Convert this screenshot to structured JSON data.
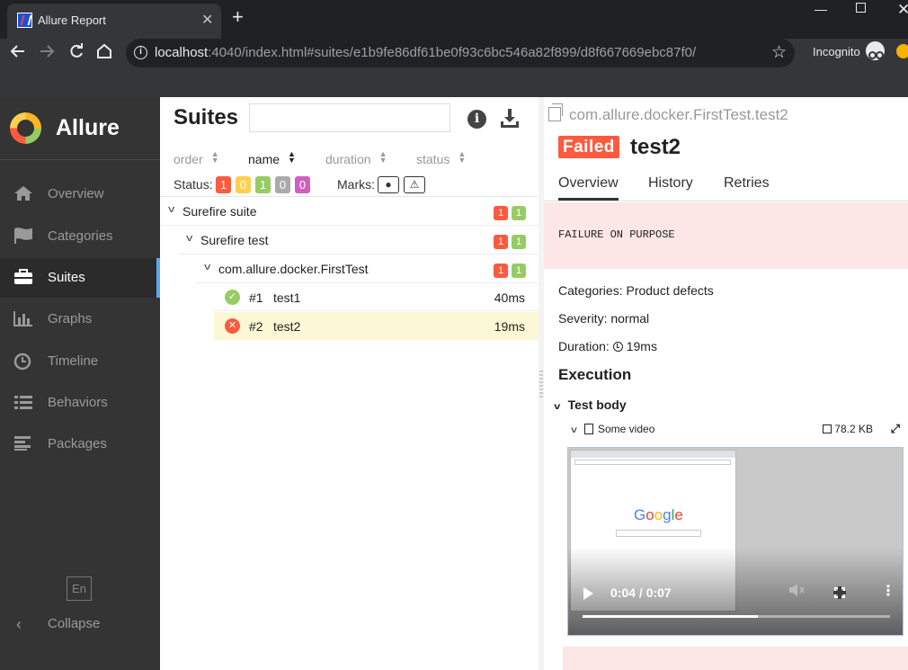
{
  "browser": {
    "tab_title": "Allure Report",
    "tab_close": "✕",
    "new_tab": "+",
    "url_host": "localhost",
    "url_rest": ":4040/index.html#suites/e1b9fe86df61be0f93c6bc546a82f899/d8f667669ebc87f0/",
    "incognito_label": "Incognito",
    "win_min": "—",
    "win_close": "✕",
    "icons": {
      "back": "arrow-left-icon",
      "forward": "arrow-right-icon",
      "reload": "reload-icon",
      "home": "home-icon",
      "star": "star-icon"
    }
  },
  "sidebar": {
    "brand": "Allure",
    "items": [
      {
        "label": "Overview",
        "icon": "home-icon",
        "active": false
      },
      {
        "label": "Categories",
        "icon": "flag-icon",
        "active": false
      },
      {
        "label": "Suites",
        "icon": "briefcase-icon",
        "active": true
      },
      {
        "label": "Graphs",
        "icon": "bar-chart-icon",
        "active": false
      },
      {
        "label": "Timeline",
        "icon": "clock-icon",
        "active": false
      },
      {
        "label": "Behaviors",
        "icon": "list-icon",
        "active": false
      },
      {
        "label": "Packages",
        "icon": "align-left-icon",
        "active": false
      }
    ],
    "language": "En",
    "collapse": "Collapse"
  },
  "suites": {
    "title": "Suites",
    "search_value": "",
    "columns": [
      "order",
      "name",
      "duration",
      "status"
    ],
    "sorted_column": "name",
    "status_label": "Status:",
    "status_counts": [
      {
        "value": "1",
        "color": "#fd5a3e",
        "status": "failed"
      },
      {
        "value": "0",
        "color": "#ffd050",
        "status": "broken"
      },
      {
        "value": "1",
        "color": "#97cc64",
        "status": "passed"
      },
      {
        "value": "0",
        "color": "#aaaaaa",
        "status": "skipped"
      },
      {
        "value": "0",
        "color": "#d35ebe",
        "status": "unknown"
      }
    ],
    "marks_label": "Marks:",
    "marks": [
      {
        "icon": "bomb-icon",
        "glyph": "💣"
      },
      {
        "icon": "warning-icon",
        "glyph": "⚠"
      }
    ],
    "tree": [
      {
        "label": "Surefire suite",
        "failed": "1",
        "passed": "1"
      },
      {
        "label": "Surefire test",
        "failed": "1",
        "passed": "1"
      },
      {
        "label": "com.allure.docker.FirstTest",
        "failed": "1",
        "passed": "1"
      }
    ],
    "tests": [
      {
        "num": "#1",
        "name": "test1",
        "duration": "40ms",
        "status": "passed",
        "selected": false
      },
      {
        "num": "#2",
        "name": "test2",
        "duration": "19ms",
        "status": "failed",
        "selected": true
      }
    ]
  },
  "detail": {
    "path": "com.allure.docker.FirstTest.test2",
    "status": "Failed",
    "name": "test2",
    "tabs": [
      "Overview",
      "History",
      "Retries"
    ],
    "active_tab": "Overview",
    "failure_message": "FAILURE ON PURPOSE",
    "categories_line": "Categories: Product defects",
    "severity_line": "Severity: normal",
    "duration_label": "Duration:",
    "duration_value": "19ms",
    "execution_title": "Execution",
    "test_body_title": "Test body",
    "attachment": {
      "name": "Some video",
      "size": "78.2 KB",
      "video_time": "0:04 / 0:07",
      "progress": 0.57
    },
    "video_logo": [
      "G",
      "o",
      "o",
      "g",
      "l",
      "e"
    ]
  },
  "colors": {
    "failed": "#fd5a3e",
    "passed": "#97cc64",
    "sidebar_bg": "#343434",
    "active_accent": "#5ba8f3",
    "selected_row": "#fcf7d5",
    "failure_bg": "#fde6e6"
  }
}
